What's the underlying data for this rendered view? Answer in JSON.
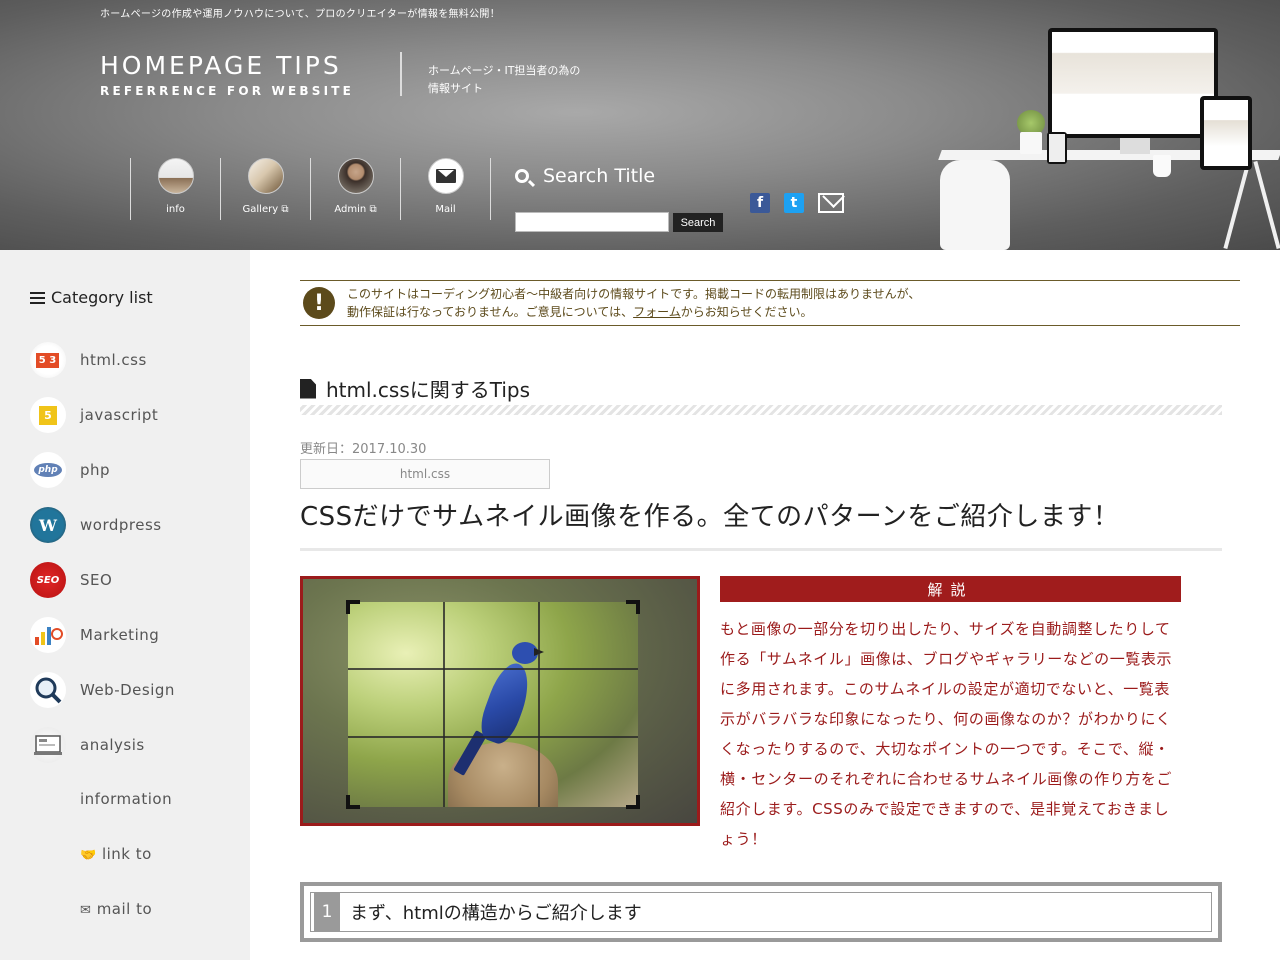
{
  "header": {
    "tagline": "ホームページの作成や運用ノウハウについて、プロのクリエイターが情報を無料公開！",
    "logo_main": "HOMEPAGE TIPS",
    "logo_sub": "REFERRENCE FOR WEBSITE",
    "desc_line1": "ホームページ・IT担当者の為の",
    "desc_line2": "情報サイト",
    "nav": [
      {
        "label": "info",
        "icon": "info-thumbnail"
      },
      {
        "label": "Gallery ⧉",
        "icon": "gallery-thumbnail"
      },
      {
        "label": "Admin ⧉",
        "icon": "admin-avatar"
      },
      {
        "label": "Mail",
        "icon": "mail-icon"
      }
    ],
    "search_title": "Search Title",
    "search_button": "Search",
    "search_value": "",
    "social": [
      "facebook-icon",
      "twitter-icon",
      "mail-icon"
    ],
    "social_labels": [
      "f",
      "t"
    ]
  },
  "sidebar": {
    "title": "Category list",
    "items": [
      {
        "label": "html.css",
        "icon": "html5-css3-icon"
      },
      {
        "label": "javascript",
        "icon": "js-icon"
      },
      {
        "label": "php",
        "icon": "php-icon"
      },
      {
        "label": "wordpress",
        "icon": "wordpress-icon"
      },
      {
        "label": "SEO",
        "icon": "seo-icon"
      },
      {
        "label": "Marketing",
        "icon": "marketing-icon"
      },
      {
        "label": "Web-Design",
        "icon": "web-design-icon"
      },
      {
        "label": "analysis",
        "icon": "analysis-icon"
      }
    ],
    "icon_texts": {
      "html": "5 3",
      "js": "5",
      "php": "php",
      "wp": "W",
      "seo": "SEO"
    },
    "extra": [
      {
        "label": "information"
      },
      {
        "label": "link to",
        "icon": "handshake-icon"
      },
      {
        "label": "mail to",
        "icon": "envelope-icon"
      }
    ]
  },
  "notice": {
    "line1": "このサイトはコーディング初心者〜中級者向けの情報サイトです。掲載コードの転用制限はありませんが、",
    "line2_pre": "動作保証は行なっておりません。ご意見については、",
    "line2_link": "フォーム",
    "line2_post": "からお知らせください。"
  },
  "main": {
    "section_title": "html.cssに関するTips",
    "date": "更新日：2017.10.30",
    "tag": "html.css",
    "article_title": "CSSだけでサムネイル画像を作る。全てのパターンをご紹介します！",
    "explain_head": "解説",
    "explain_text": "もと画像の一部分を切り出したり、サイズを自動調整したりして作る「サムネイル」画像は、ブログやギャラリーなどの一覧表示に多用されます。このサムネイルの設定が適切でないと、一覧表示がバラバラな印象になったり、何の画像なのか？がわかりにくくなったりするので、大切なポイントの一つです。そこで、縦・横・センターのそれぞれに合わせるサムネイル画像の作り方をご紹介します。CSSのみで設定できますので、是非覚えておきましょう！",
    "h2_num": "1",
    "h2_text": "まず、htmlの構造からご紹介します"
  },
  "colors": {
    "accent_red": "#9b1b1b",
    "notice_brown": "#5c4a1b",
    "sidebar_bg": "#f0f0f0"
  }
}
